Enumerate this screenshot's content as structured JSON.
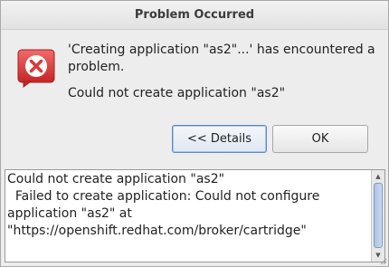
{
  "dialog": {
    "title": "Problem Occurred",
    "message": "'Creating application \"as2\"...' has encountered a problem.",
    "detail_message": "Could not create application \"as2\"",
    "icon": "error-icon"
  },
  "buttons": {
    "details_label": "<< Details",
    "ok_label": "OK"
  },
  "details": {
    "text": "Could not create application \"as2\"\n  Failed to create application: Could not configure application \"as2\" at \"https://openshift.redhat.com/broker/cartridge\""
  },
  "colors": {
    "error_red": "#d93a3a",
    "focus_border": "#5c8ac8"
  }
}
